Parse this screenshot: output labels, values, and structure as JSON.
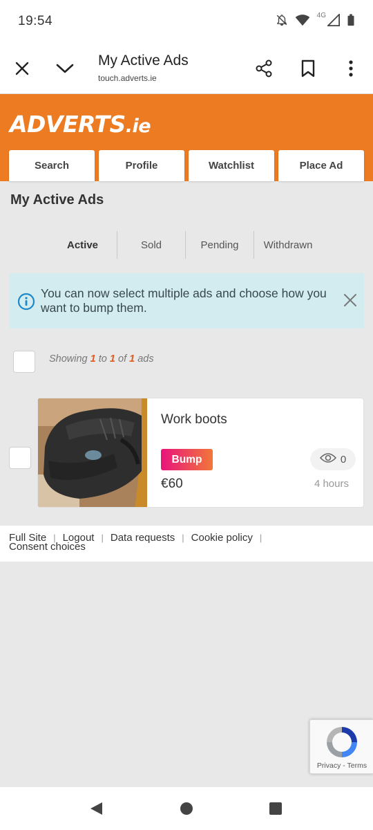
{
  "status_bar": {
    "time": "19:54",
    "network_label": "4G",
    "icons": [
      "notifications-off-icon",
      "wifi-icon",
      "signal-icon",
      "battery-icon"
    ]
  },
  "browser": {
    "title": "My Active Ads",
    "url": "touch.adverts.ie",
    "icons": [
      "close-icon",
      "chevron-down-icon",
      "share-icon",
      "bookmark-icon",
      "more-vert-icon"
    ]
  },
  "site": {
    "logo_main": "ADVERTS",
    "logo_suffix": ".ie",
    "brand_color": "#ec7b22",
    "nav": [
      {
        "label": "Search"
      },
      {
        "label": "Profile"
      },
      {
        "label": "Watchlist"
      },
      {
        "label": "Place Ad"
      }
    ]
  },
  "page": {
    "heading": "My Active Ads",
    "tabs": [
      {
        "label": "Active",
        "selected": true
      },
      {
        "label": "Sold",
        "selected": false
      },
      {
        "label": "Pending",
        "selected": false
      },
      {
        "label": "Withdrawn",
        "selected": false
      }
    ],
    "info_banner": {
      "text": "You can now select multiple ads and choose how you want to bump them."
    },
    "showing": {
      "prefix": "Showing",
      "from": "1",
      "to_word": "to",
      "to": "1",
      "of_word": "of",
      "total": "1",
      "suffix": "ads"
    }
  },
  "ads": [
    {
      "title": "Work boots",
      "bump_label": "Bump",
      "price": "€60",
      "views": "0",
      "age": "4 hours"
    }
  ],
  "footer": {
    "links": [
      "Full Site",
      "Logout",
      "Data requests",
      "Cookie policy",
      "Consent choices"
    ]
  },
  "recaptcha": {
    "privacy": "Privacy",
    "separator": "-",
    "terms": "Terms"
  }
}
